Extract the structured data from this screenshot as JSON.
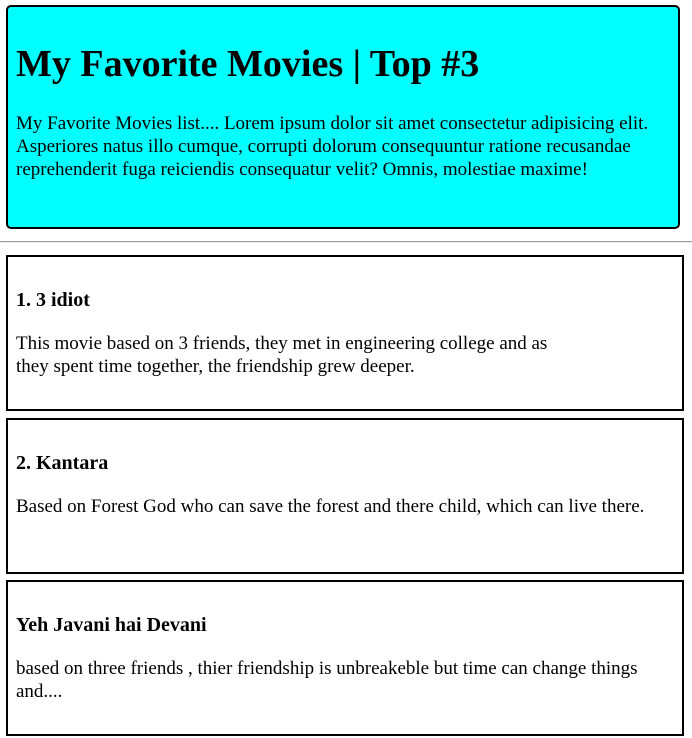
{
  "colors": {
    "hero_background": "#00ffff",
    "card_background": "#ffffff",
    "border": "#000000"
  },
  "hero": {
    "title": "My Favorite Movies | Top #3",
    "description": "My Favorite Movies list.... Lorem ipsum dolor sit amet consectetur adipisicing elit. Asperiores natus illo cumque, corrupti dolorum consequuntur ratione recusandae reprehenderit fuga reiciendis consequatur velit? Omnis, molestiae maxime!"
  },
  "movies": [
    {
      "title": "1. 3 idiot",
      "description": "This movie based on 3 friends, they met in engineering college and as they spent time together, the friendship grew deeper."
    },
    {
      "title": "2. Kantara",
      "description": "Based on Forest God who can save the forest and there child, which can live there."
    },
    {
      "title": "Yeh Javani hai Devani",
      "description": "based on three friends , thier friendship is unbreakeble but time can change things and...."
    }
  ]
}
